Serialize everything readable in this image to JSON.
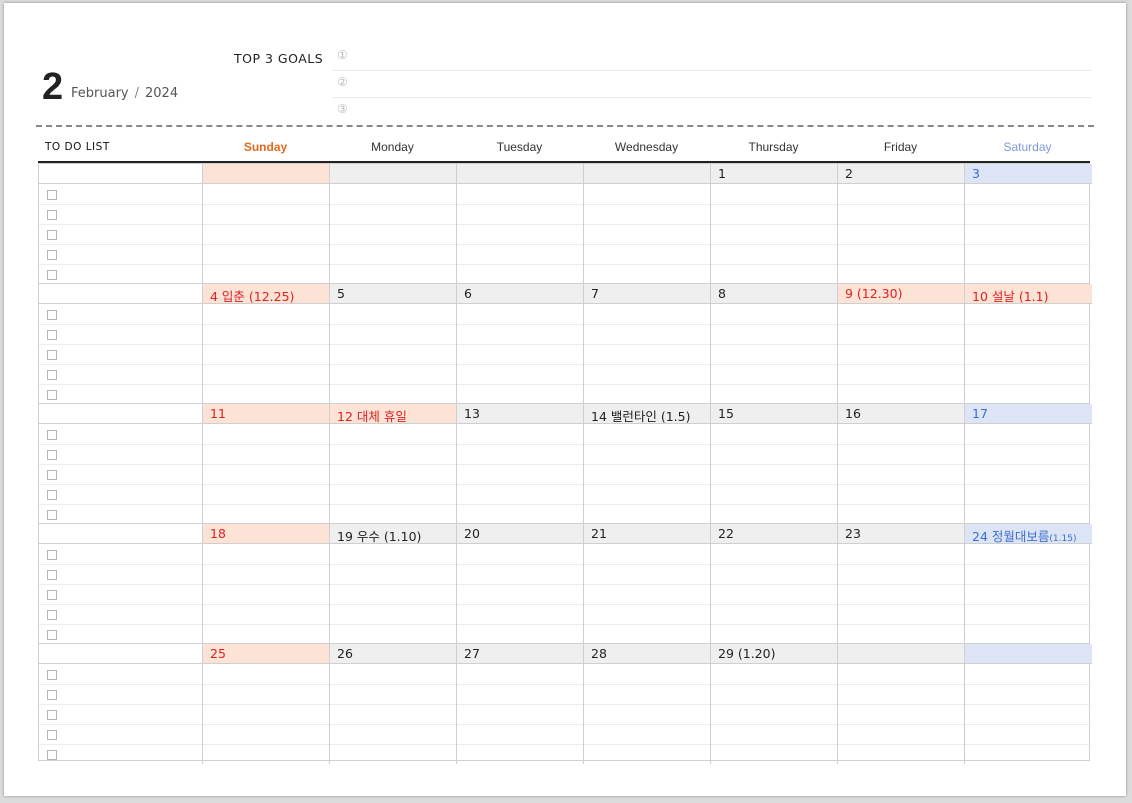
{
  "header": {
    "month_number": "2",
    "month_name": "February",
    "separator": "/",
    "year": "2024",
    "goals_title": "TOP 3 GOALS",
    "goal_marks": [
      "①",
      "②",
      "③"
    ]
  },
  "table": {
    "todo_label": "TO DO LIST",
    "weekdays": [
      {
        "label": "Sunday",
        "color": "#e06a1f",
        "bold": true
      },
      {
        "label": "Monday",
        "color": "#333333",
        "bold": false
      },
      {
        "label": "Tuesday",
        "color": "#333333",
        "bold": false
      },
      {
        "label": "Wednesday",
        "color": "#333333",
        "bold": false
      },
      {
        "label": "Thursday",
        "color": "#333333",
        "bold": false
      },
      {
        "label": "Friday",
        "color": "#333333",
        "bold": false
      },
      {
        "label": "Saturday",
        "color": "#7d9ad6",
        "bold": false
      }
    ]
  },
  "weeks": [
    [
      {
        "text": "",
        "bg": "sun",
        "color": ""
      },
      {
        "text": "",
        "bg": "",
        "color": ""
      },
      {
        "text": "",
        "bg": "",
        "color": ""
      },
      {
        "text": "",
        "bg": "",
        "color": ""
      },
      {
        "text": "1",
        "bg": "",
        "color": ""
      },
      {
        "text": "2",
        "bg": "",
        "color": ""
      },
      {
        "text": "3",
        "bg": "sat",
        "color": "blue"
      }
    ],
    [
      {
        "text": "4  입춘  (12.25)",
        "bg": "sun",
        "color": "red"
      },
      {
        "text": "5",
        "bg": "",
        "color": ""
      },
      {
        "text": "6",
        "bg": "",
        "color": ""
      },
      {
        "text": "7",
        "bg": "",
        "color": ""
      },
      {
        "text": "8",
        "bg": "",
        "color": ""
      },
      {
        "text": "9  (12.30)",
        "bg": "red",
        "color": "red"
      },
      {
        "text": "10  설날  (1.1)",
        "bg": "red",
        "color": "red"
      }
    ],
    [
      {
        "text": "11",
        "bg": "sun",
        "color": "red"
      },
      {
        "text": "12  대체  휴일",
        "bg": "red",
        "color": "red"
      },
      {
        "text": "13",
        "bg": "",
        "color": ""
      },
      {
        "text": "14  밸런타인  (1.5)",
        "bg": "",
        "color": ""
      },
      {
        "text": "15",
        "bg": "",
        "color": ""
      },
      {
        "text": "16",
        "bg": "",
        "color": ""
      },
      {
        "text": "17",
        "bg": "sat",
        "color": "blue"
      }
    ],
    [
      {
        "text": "18",
        "bg": "sun",
        "color": "red"
      },
      {
        "text": "19  우수  (1.10)",
        "bg": "",
        "color": ""
      },
      {
        "text": "20",
        "bg": "",
        "color": ""
      },
      {
        "text": "21",
        "bg": "",
        "color": ""
      },
      {
        "text": "22",
        "bg": "",
        "color": ""
      },
      {
        "text": "23",
        "bg": "",
        "color": ""
      },
      {
        "text": "24  정월대보름",
        "suffix": "(1.15)",
        "bg": "sat",
        "color": "blue"
      }
    ],
    [
      {
        "text": "25",
        "bg": "sun",
        "color": "red"
      },
      {
        "text": "26",
        "bg": "",
        "color": ""
      },
      {
        "text": "27",
        "bg": "",
        "color": ""
      },
      {
        "text": "28",
        "bg": "",
        "color": ""
      },
      {
        "text": "29  (1.20)",
        "bg": "",
        "color": ""
      },
      {
        "text": "",
        "bg": "",
        "color": ""
      },
      {
        "text": "",
        "bg": "sat",
        "color": ""
      }
    ]
  ]
}
